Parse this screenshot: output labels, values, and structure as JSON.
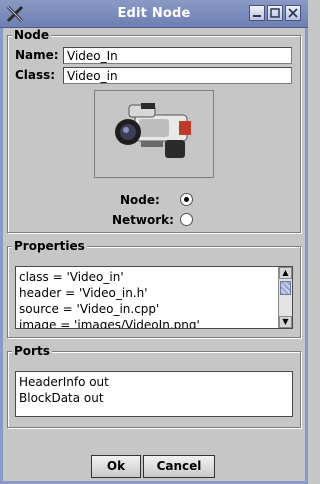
{
  "window": {
    "title": "Edit Node",
    "app_icon": "x-icon",
    "controls": [
      "minimize-icon",
      "maximize-icon",
      "close-icon"
    ]
  },
  "node_group": {
    "legend": "Node",
    "name_label": "Name:",
    "name_value": "Video_In",
    "class_label": "Class:",
    "class_value": "Video_in",
    "image": "video-camera-icon",
    "node_radio_label": "Node:",
    "node_selected": true,
    "network_radio_label": "Network:",
    "network_selected": false
  },
  "properties_group": {
    "legend": "Properties",
    "lines": [
      "class = 'Video_in'",
      "header = 'Video_in.h'",
      "source = 'Video_in.cpp'",
      "image = 'images/VideoIn.png'"
    ]
  },
  "ports_group": {
    "legend": "Ports",
    "lines": [
      "HeaderInfo out",
      "BlockData out"
    ]
  },
  "buttons": {
    "ok": "Ok",
    "cancel": "Cancel"
  },
  "colors": {
    "titlebar": "#8a9ac6",
    "background": "#c6c6c6"
  }
}
